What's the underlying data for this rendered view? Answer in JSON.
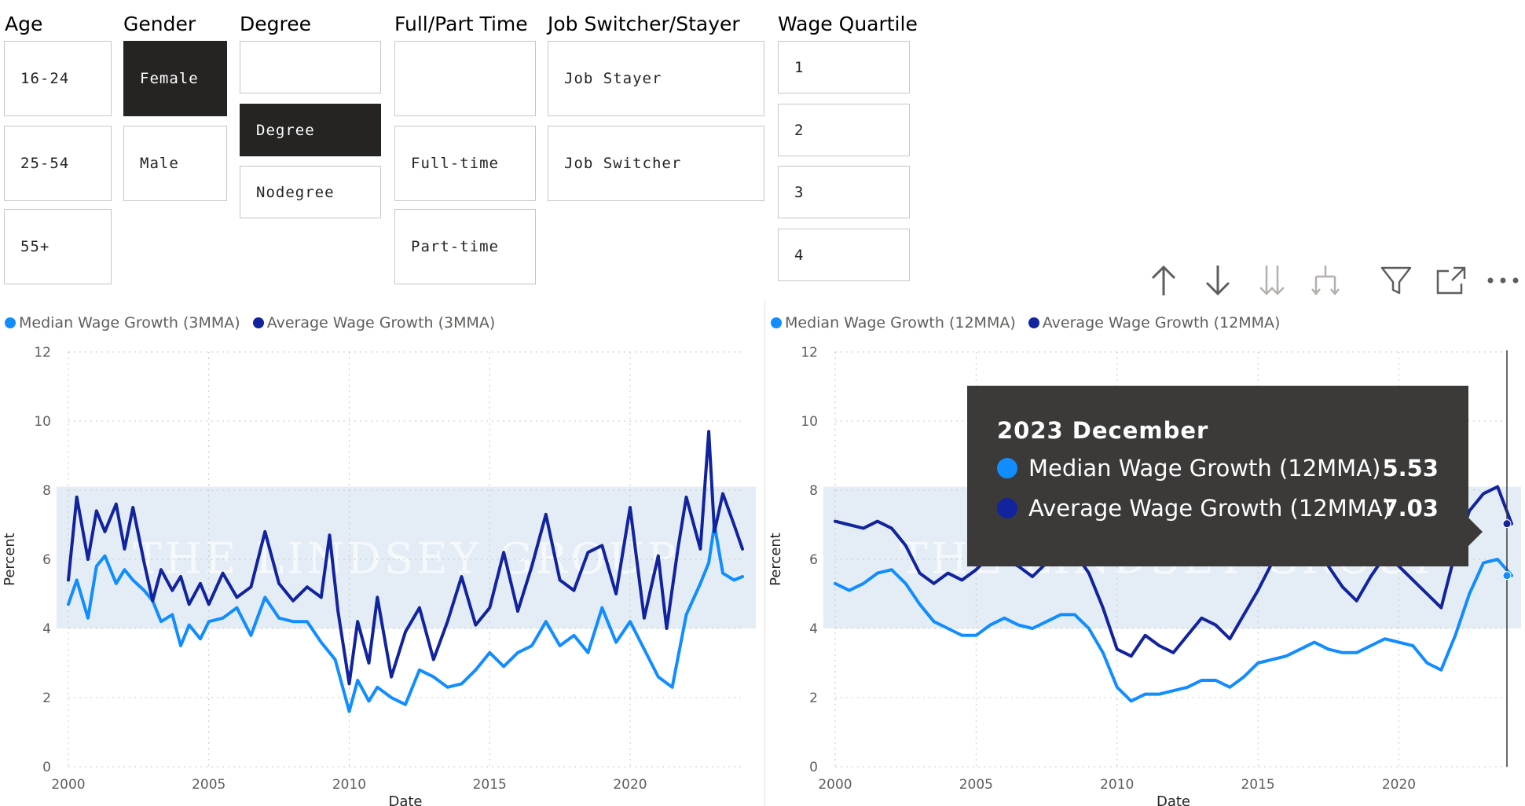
{
  "colors": {
    "median": "#118DFF",
    "average": "#12239E",
    "selected_bg": "#252423",
    "band": "#dde8f3",
    "tooltip_bg": "#3b3a39"
  },
  "slicers": {
    "age": {
      "title": "Age",
      "options": [
        "16-24",
        "25-54",
        "55+"
      ]
    },
    "gender": {
      "title": "Gender",
      "options": [
        "Female",
        "Male"
      ],
      "selected": "Female"
    },
    "degree": {
      "title": "Degree",
      "options": [
        "",
        "Degree",
        "Nodegree"
      ],
      "selected": "Degree"
    },
    "fulltime": {
      "title": "Full/Part Time",
      "options": [
        "",
        "Full-time",
        "Part-time"
      ]
    },
    "switcher": {
      "title": "Job Switcher/Stayer",
      "options": [
        "Job Stayer",
        "Job Switcher"
      ]
    },
    "quartile": {
      "title": "Wage Quartile",
      "options": [
        "1",
        "2",
        "3",
        "4"
      ]
    }
  },
  "toolbar": {
    "icons": [
      "drill-up-icon",
      "drill-down-icon",
      "expand-all-icon",
      "drill-hierarchy-icon",
      "filter-icon",
      "focus-mode-icon",
      "more-options-icon"
    ]
  },
  "watermark": "THE LINDSEY GROUP",
  "chart_data": [
    {
      "type": "line",
      "legend": [
        "Median Wage Growth (3MMA)",
        "Average Wage Growth (3MMA)"
      ],
      "xlabel": "Date",
      "ylabel": "Percent",
      "x_ticks": [
        "2000",
        "2005",
        "2010",
        "2015",
        "2020"
      ],
      "y_ticks": [
        "0",
        "2",
        "4",
        "6",
        "8",
        "10",
        "12"
      ],
      "xlim": [
        2000,
        2024
      ],
      "ylim": [
        0,
        12
      ],
      "grid": true,
      "band": [
        4,
        8.1
      ],
      "series": [
        {
          "name": "Median Wage Growth (3MMA)",
          "x": [
            2000.0,
            2000.3,
            2000.7,
            2001.0,
            2001.3,
            2001.7,
            2002.0,
            2002.3,
            2002.7,
            2003.0,
            2003.3,
            2003.7,
            2004.0,
            2004.3,
            2004.7,
            2005.0,
            2005.5,
            2006.0,
            2006.5,
            2007.0,
            2007.5,
            2008.0,
            2008.5,
            2009.0,
            2009.5,
            2010.0,
            2010.3,
            2010.7,
            2011.0,
            2011.5,
            2012.0,
            2012.5,
            2013.0,
            2013.5,
            2014.0,
            2014.5,
            2015.0,
            2015.5,
            2016.0,
            2016.5,
            2017.0,
            2017.5,
            2018.0,
            2018.5,
            2019.0,
            2019.5,
            2020.0,
            2020.5,
            2021.0,
            2021.5,
            2022.0,
            2022.5,
            2022.8,
            2023.0,
            2023.3,
            2023.7,
            2024.0
          ],
          "values": [
            4.7,
            5.4,
            4.3,
            5.8,
            6.1,
            5.3,
            5.7,
            5.4,
            5.1,
            4.8,
            4.2,
            4.4,
            3.5,
            4.1,
            3.7,
            4.2,
            4.3,
            4.6,
            3.8,
            4.9,
            4.3,
            4.2,
            4.2,
            3.6,
            3.1,
            1.6,
            2.5,
            1.9,
            2.3,
            2.0,
            1.8,
            2.8,
            2.6,
            2.3,
            2.4,
            2.8,
            3.3,
            2.9,
            3.3,
            3.5,
            4.2,
            3.5,
            3.8,
            3.3,
            4.6,
            3.6,
            4.2,
            3.4,
            2.6,
            2.3,
            4.4,
            5.3,
            5.9,
            7.0,
            5.6,
            5.4,
            5.5
          ]
        },
        {
          "name": "Average Wage Growth (3MMA)",
          "x": [
            2000.0,
            2000.3,
            2000.7,
            2001.0,
            2001.3,
            2001.7,
            2002.0,
            2002.3,
            2002.7,
            2003.0,
            2003.3,
            2003.7,
            2004.0,
            2004.3,
            2004.7,
            2005.0,
            2005.5,
            2006.0,
            2006.5,
            2007.0,
            2007.5,
            2008.0,
            2008.5,
            2009.0,
            2009.3,
            2009.6,
            2010.0,
            2010.3,
            2010.7,
            2011.0,
            2011.5,
            2012.0,
            2012.5,
            2013.0,
            2013.5,
            2014.0,
            2014.5,
            2015.0,
            2015.5,
            2016.0,
            2016.5,
            2017.0,
            2017.5,
            2018.0,
            2018.5,
            2019.0,
            2019.5,
            2020.0,
            2020.5,
            2021.0,
            2021.3,
            2021.7,
            2022.0,
            2022.5,
            2022.8,
            2023.0,
            2023.3,
            2023.7,
            2024.0
          ],
          "values": [
            5.4,
            7.8,
            6.0,
            7.4,
            6.8,
            7.6,
            6.3,
            7.5,
            5.9,
            4.8,
            5.7,
            5.1,
            5.5,
            4.7,
            5.3,
            4.7,
            5.6,
            4.9,
            5.2,
            6.8,
            5.3,
            4.8,
            5.2,
            4.9,
            6.7,
            4.5,
            2.4,
            4.2,
            3.0,
            4.9,
            2.6,
            3.9,
            4.6,
            3.1,
            4.2,
            5.5,
            4.1,
            4.6,
            6.2,
            4.5,
            5.8,
            7.3,
            5.4,
            5.1,
            6.2,
            6.4,
            5.0,
            7.5,
            4.3,
            6.1,
            4.0,
            6.3,
            7.8,
            6.3,
            9.7,
            6.8,
            7.9,
            7.0,
            6.3
          ]
        }
      ]
    },
    {
      "type": "line",
      "legend": [
        "Median Wage Growth (12MMA)",
        "Average Wage Growth (12MMA)"
      ],
      "xlabel": "Date",
      "ylabel": "Percent",
      "x_ticks": [
        "2000",
        "2005",
        "2010",
        "2015",
        "2020"
      ],
      "y_ticks": [
        "0",
        "2",
        "4",
        "6",
        "8",
        "10",
        "12"
      ],
      "xlim": [
        2000,
        2024
      ],
      "ylim": [
        0,
        12
      ],
      "grid": true,
      "band": [
        4,
        8.1
      ],
      "series": [
        {
          "name": "Median Wage Growth (12MMA)",
          "x": [
            2000.0,
            2000.5,
            2001.0,
            2001.5,
            2002.0,
            2002.5,
            2003.0,
            2003.5,
            2004.0,
            2004.5,
            2005.0,
            2005.5,
            2006.0,
            2006.5,
            2007.0,
            2007.5,
            2008.0,
            2008.5,
            2009.0,
            2009.5,
            2010.0,
            2010.5,
            2011.0,
            2011.5,
            2012.0,
            2012.5,
            2013.0,
            2013.5,
            2014.0,
            2014.5,
            2015.0,
            2015.5,
            2016.0,
            2016.5,
            2017.0,
            2017.5,
            2018.0,
            2018.5,
            2019.0,
            2019.5,
            2020.0,
            2020.5,
            2021.0,
            2021.5,
            2022.0,
            2022.5,
            2023.0,
            2023.5,
            2024.0
          ],
          "values": [
            5.3,
            5.1,
            5.3,
            5.6,
            5.7,
            5.3,
            4.7,
            4.2,
            4.0,
            3.8,
            3.8,
            4.1,
            4.3,
            4.1,
            4.0,
            4.2,
            4.4,
            4.4,
            4.0,
            3.3,
            2.3,
            1.9,
            2.1,
            2.1,
            2.2,
            2.3,
            2.5,
            2.5,
            2.3,
            2.6,
            3.0,
            3.1,
            3.2,
            3.4,
            3.6,
            3.4,
            3.3,
            3.3,
            3.5,
            3.7,
            3.6,
            3.5,
            3.0,
            2.8,
            3.8,
            5.0,
            5.9,
            6.0,
            5.53
          ]
        },
        {
          "name": "Average Wage Growth (12MMA)",
          "x": [
            2000.0,
            2000.5,
            2001.0,
            2001.5,
            2002.0,
            2002.5,
            2003.0,
            2003.5,
            2004.0,
            2004.5,
            2005.0,
            2005.5,
            2006.0,
            2006.5,
            2007.0,
            2007.5,
            2008.0,
            2008.5,
            2009.0,
            2009.5,
            2010.0,
            2010.5,
            2011.0,
            2011.5,
            2012.0,
            2012.5,
            2013.0,
            2013.5,
            2014.0,
            2014.5,
            2015.0,
            2015.5,
            2016.0,
            2016.5,
            2017.0,
            2017.5,
            2018.0,
            2018.5,
            2019.0,
            2019.5,
            2020.0,
            2020.5,
            2021.0,
            2021.5,
            2022.0,
            2022.5,
            2023.0,
            2023.5,
            2024.0
          ],
          "values": [
            7.1,
            7.0,
            6.9,
            7.1,
            6.9,
            6.4,
            5.6,
            5.3,
            5.6,
            5.4,
            5.7,
            6.1,
            6.0,
            5.8,
            5.5,
            5.9,
            5.9,
            6.2,
            5.6,
            4.6,
            3.4,
            3.2,
            3.8,
            3.5,
            3.3,
            3.8,
            4.3,
            4.1,
            3.7,
            4.4,
            5.1,
            5.9,
            6.1,
            6.0,
            6.4,
            5.8,
            5.2,
            4.8,
            5.5,
            6.1,
            5.8,
            5.4,
            5.0,
            4.6,
            6.2,
            7.4,
            7.9,
            8.1,
            7.03
          ]
        }
      ]
    }
  ],
  "tooltip": {
    "title": "2023 December",
    "rows": [
      {
        "label": "Median Wage Growth (12MMA)",
        "value": "5.53"
      },
      {
        "label": "Average Wage Growth (12MMA)",
        "value": "7.03"
      }
    ]
  }
}
